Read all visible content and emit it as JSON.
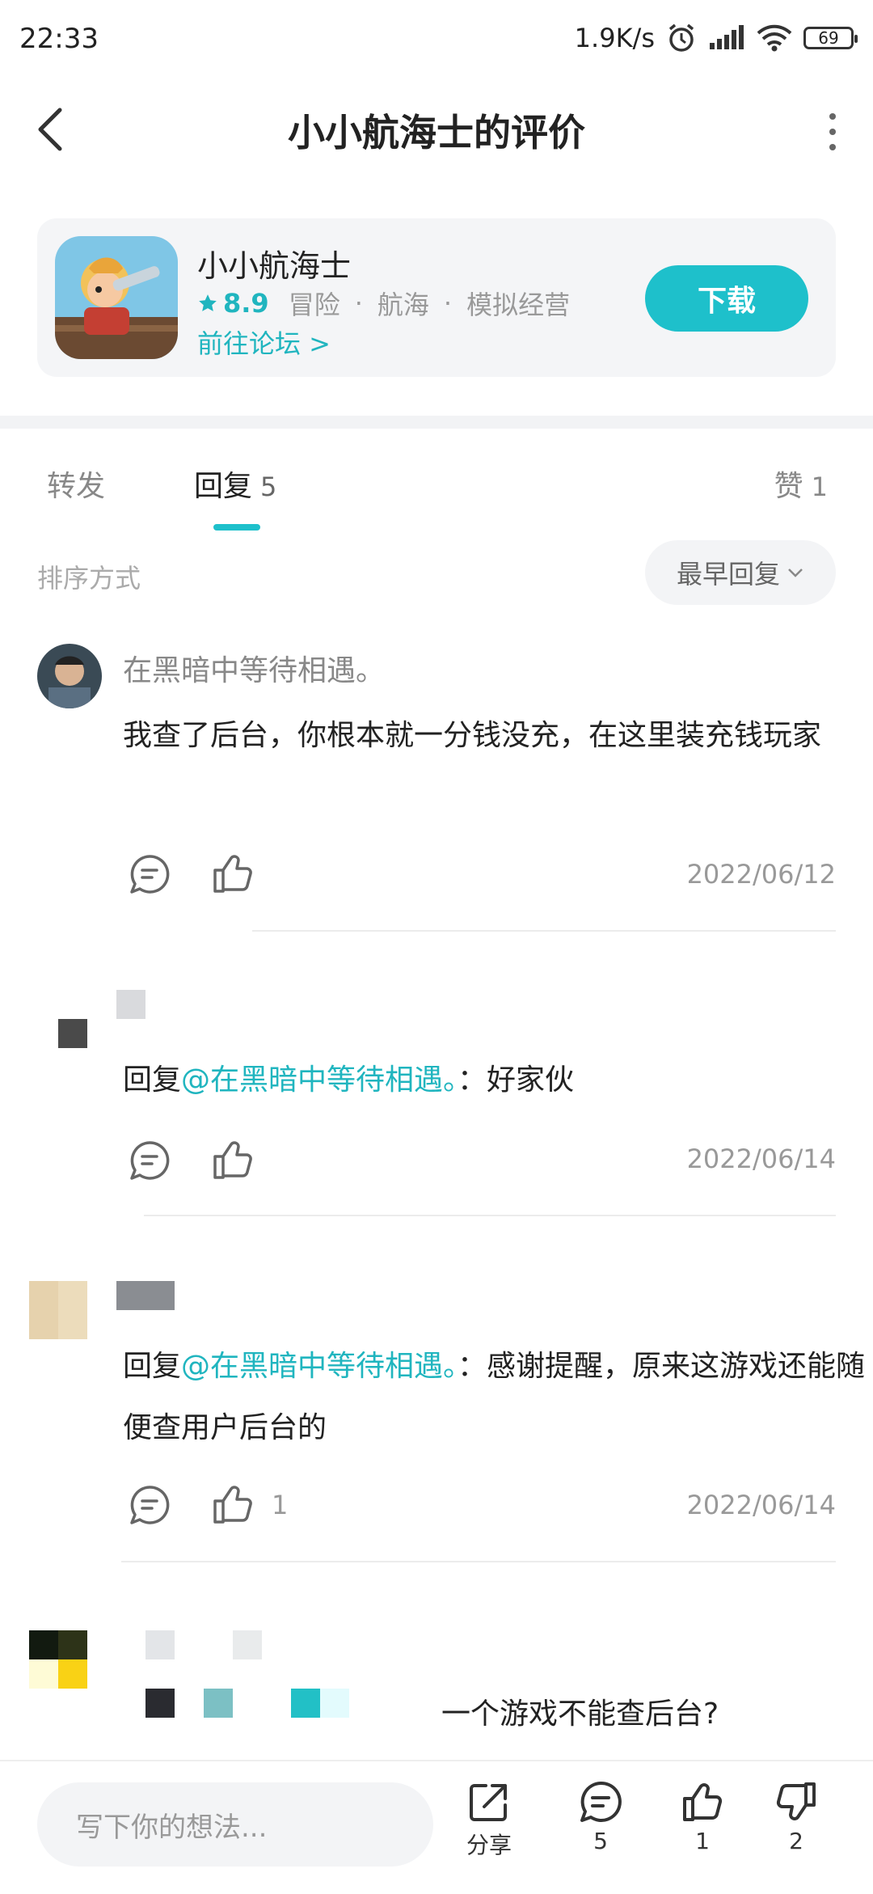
{
  "status": {
    "time": "22:33",
    "speed": "1.9K/s",
    "battery": "69"
  },
  "header": {
    "title": "小小航海士的评价"
  },
  "app": {
    "name": "小小航海士",
    "rating": "8.9",
    "tags": [
      "冒险",
      "航海",
      "模拟经营"
    ],
    "forum_link": "前往论坛 >",
    "download_label": "下载"
  },
  "tabs": {
    "forward": "转发",
    "reply": "回复",
    "reply_count": "5",
    "like": "赞",
    "like_count": "1"
  },
  "sort": {
    "label": "排序方式",
    "selected": "最早回复"
  },
  "comments": [
    {
      "author": "在黑暗中等待相遇。",
      "text": "我查了后台，你根本就一分钱没充，在这里装充钱玩家",
      "date": "2022/06/12",
      "like_count": ""
    },
    {
      "reply_prefix": "回复",
      "mention": "@在黑暗中等待相遇。",
      "text": "：好家伙",
      "date": "2022/06/14",
      "like_count": ""
    },
    {
      "reply_prefix": "回复",
      "mention": "@在黑暗中等待相遇。",
      "text": "：感谢提醒，原来这游戏还能随便查用户后台的",
      "date": "2022/06/14",
      "like_count": "1"
    },
    {
      "text": "一个游戏不能查后台?"
    }
  ],
  "bottom": {
    "placeholder": "写下你的想法...",
    "share_label": "分享",
    "comment_count": "5",
    "like_count": "1",
    "dislike_count": "2"
  }
}
